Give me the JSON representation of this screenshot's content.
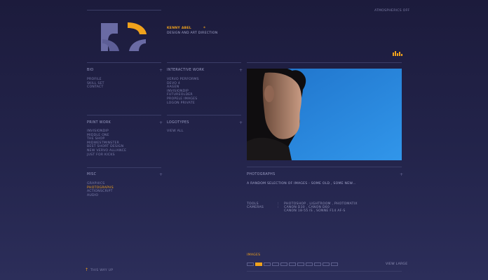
{
  "header": {
    "top_link": "ATMOSPHERICS OFF",
    "name": "KENNY ABEL",
    "tagline": "DESIGN AND ART DIRECTION",
    "asterisk": "*",
    "brand_color": "#f0a21c"
  },
  "bio": {
    "title": "BIO",
    "items": [
      "PROFILE",
      "SKILL SET",
      "CONTACT"
    ]
  },
  "interactive_work": {
    "title": "INTERACTIVE WORK",
    "items": [
      "VERVO PERFORMS",
      "DEVO 4",
      "AAGEN",
      "INVISIONDIP",
      "FUTUREOLDER",
      "PROPELE IMAGES",
      "LOGON PRIVATE"
    ]
  },
  "print_work": {
    "title": "PRINT WORK",
    "items": [
      "INVISIONDIP",
      "MIDDLE ONE",
      "THE SHOP",
      "MIDWESTMINSTER",
      "BEST SHORT DESIGN",
      "NEW VERVO ALLIANCE",
      "JUST FOR KICKS"
    ]
  },
  "logotypes": {
    "title": "LOGOTYPES",
    "items": [
      "VIEW ALL"
    ]
  },
  "misc": {
    "title": "MISC",
    "items": [
      "GRAPHICS",
      "PHOTOGRAPHS",
      "ACTIONSCRIPT",
      "AUDIO"
    ],
    "active_item": "PHOTOGRAPHS"
  },
  "photo_panel": {
    "title": "PHOTOGRAPHS",
    "description": "A RANDOM SELECTION OF IMAGES - SOME OLD , SOME NEW...",
    "tools_label": "TOOLS",
    "tools_value": "PHOTOSHOP , LIGHTROOM , PHOTOMATIX",
    "cameras_label": "CAMERAS",
    "cameras_value_1": "CANON D30 , CANON D60",
    "cameras_value_2": "CANON 18-55 IS , SONNE F14 AF-S",
    "separator": ":",
    "images_label": "IMAGES",
    "thumb_count": 11,
    "active_thumb": 1,
    "view_large": "VIEW LARGE"
  },
  "plus_symbol": "+",
  "footer": {
    "top_link": "THIS WAY UP"
  }
}
